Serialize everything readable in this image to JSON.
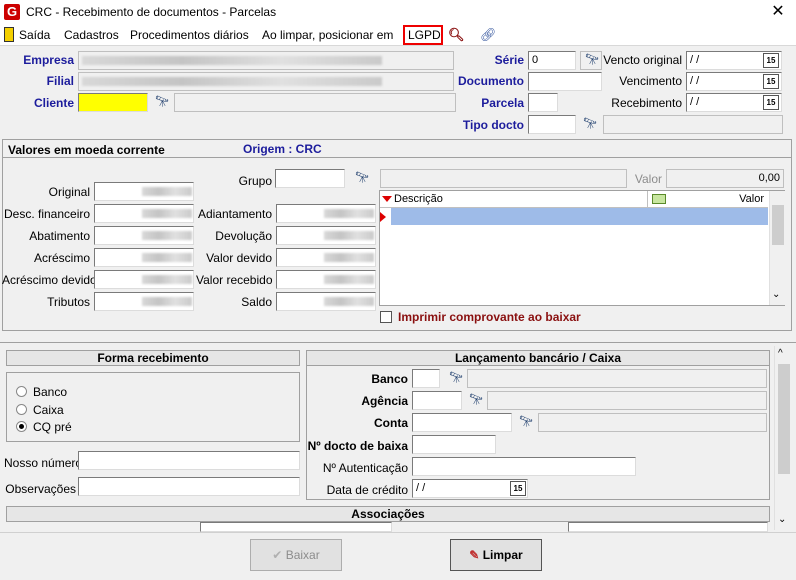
{
  "window": {
    "title": "CRC - Recebimento de documentos - Parcelas",
    "app_icon": "G"
  },
  "menu": {
    "saida": "Saída",
    "cadastros": "Cadastros",
    "procedimentos": "Procedimentos diários",
    "ao_limpar": "Ao limpar, posicionar em",
    "lgpd": "LGPD"
  },
  "header": {
    "empresa_label": "Empresa",
    "filial_label": "Filial",
    "cliente_label": "Cliente",
    "serie_label": "Série",
    "serie_value": "0",
    "documento_label": "Documento",
    "parcela_label": "Parcela",
    "tipo_docto_label": "Tipo docto",
    "vencto_original_label": "Vencto original",
    "vencto_original_value": " / /",
    "vencimento_label": "Vencimento",
    "vencimento_value": " / /",
    "recebimento_label": "Recebimento",
    "recebimento_value": " / /"
  },
  "valores": {
    "title": "Valores em moeda corrente",
    "origem": "Origem : CRC",
    "original": "Original",
    "desc_financeiro": "Desc. financeiro",
    "abatimento": "Abatimento",
    "acrescimo": "Acréscimo",
    "acrescimo_devido": "Acréscimo devido",
    "tributos": "Tributos",
    "grupo": "Grupo",
    "adiantamento": "Adiantamento",
    "devolucao": "Devolução",
    "valor_devido": "Valor devido",
    "valor_recebido": "Valor recebido",
    "saldo": "Saldo",
    "valor_label": "Valor",
    "valor_value": "0,00",
    "grid_col_descricao": "Descrição",
    "grid_col_valor": "Valor",
    "imprimir": "Imprimir comprovante ao baixar"
  },
  "forma": {
    "title": "Forma recebimento",
    "banco": "Banco",
    "caixa": "Caixa",
    "cq_pre": "CQ pré",
    "selected": "CQ pré",
    "nosso_numero": "Nosso número",
    "observacoes": "Observações"
  },
  "lancamento": {
    "title": "Lançamento bancário / Caixa",
    "banco": "Banco",
    "agencia": "Agência",
    "conta": "Conta",
    "n_docto_baixa": "Nº docto de baixa",
    "n_autenticacao": "Nº Autenticação",
    "data_credito": "Data de crédito",
    "data_credito_value": " / /"
  },
  "associacoes": {
    "title": "Associações"
  },
  "buttons": {
    "baixar": "Baixar",
    "limpar": "Limpar"
  },
  "icons": {
    "search": "magnifier-icon",
    "link": "link-icon",
    "binoculars": "binoculars-icon",
    "calendar": "calendar-icon"
  }
}
